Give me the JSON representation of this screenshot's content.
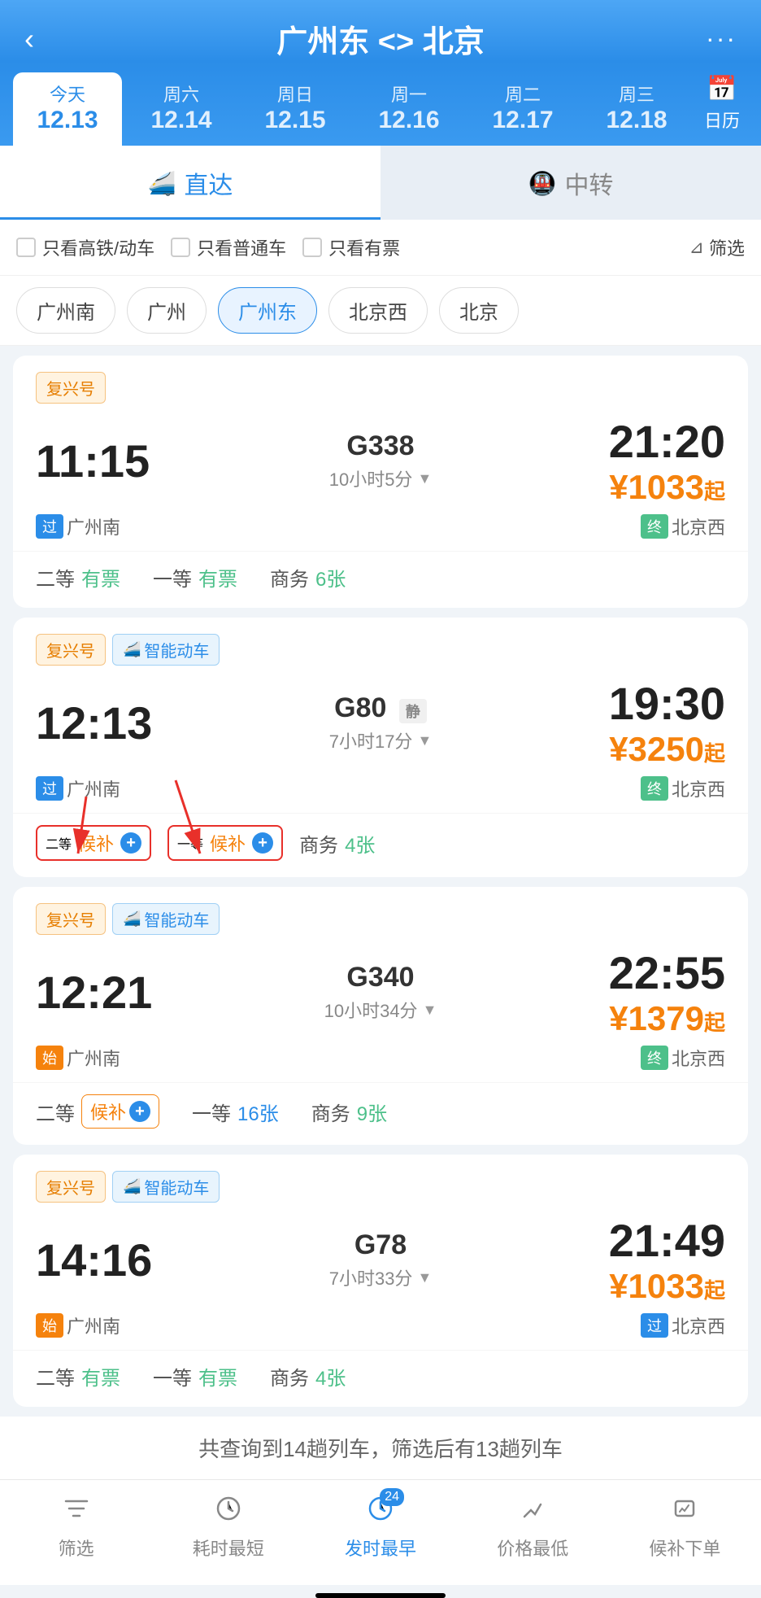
{
  "header": {
    "title": "广州东 <> 北京",
    "back_label": "‹",
    "more_label": "···"
  },
  "date_tabs": [
    {
      "day": "今天",
      "date": "12.13",
      "active": true
    },
    {
      "day": "周六",
      "date": "12.14",
      "active": false
    },
    {
      "day": "周日",
      "date": "12.15",
      "active": false
    },
    {
      "day": "周一",
      "date": "12.16",
      "active": false
    },
    {
      "day": "周二",
      "date": "12.17",
      "active": false
    },
    {
      "day": "周三",
      "date": "12.18",
      "active": false
    }
  ],
  "calendar_label": "日历",
  "tabs": {
    "direct": "直达",
    "transfer": "中转"
  },
  "filters": {
    "high_speed": "只看高铁/动车",
    "regular": "只看普通车",
    "available": "只看有票",
    "filter": "筛选"
  },
  "stations": [
    "广州南",
    "广州",
    "广州东",
    "北京西",
    "北京"
  ],
  "trains": [
    {
      "tags": [
        "复兴号"
      ],
      "depart_time": "11:15",
      "train_num": "G338",
      "arrive_time": "21:20",
      "price": "¥1033",
      "price_suffix": "起",
      "depart_station_badge": "过",
      "depart_station": "广州南",
      "arrive_station_badge": "终",
      "arrive_station": "北京西",
      "arrive_badge_color": "green",
      "duration": "10小时5分",
      "tickets": [
        {
          "class": "二等",
          "status": "有票",
          "type": "avail"
        },
        {
          "class": "一等",
          "status": "有票",
          "type": "avail"
        },
        {
          "class": "商务",
          "status": "6张",
          "type": "count"
        }
      ]
    },
    {
      "tags": [
        "复兴号",
        "智能动车"
      ],
      "depart_time": "12:13",
      "train_num": "G80",
      "quiet_badge": "静",
      "arrive_time": "19:30",
      "price": "¥3250",
      "price_suffix": "起",
      "depart_station_badge": "过",
      "depart_station": "广州南",
      "arrive_station_badge": "终",
      "arrive_station": "北京西",
      "arrive_badge_color": "green",
      "duration": "7小时17分",
      "tickets": [
        {
          "class": "二等",
          "status": "候补",
          "type": "waitlist_highlight"
        },
        {
          "class": "一等",
          "status": "候补",
          "type": "waitlist_highlight"
        },
        {
          "class": "商务",
          "status": "4张",
          "type": "count"
        }
      ]
    },
    {
      "tags": [
        "复兴号",
        "智能动车"
      ],
      "depart_time": "12:21",
      "train_num": "G340",
      "arrive_time": "22:55",
      "price": "¥1379",
      "price_suffix": "起",
      "depart_station_badge": "始",
      "depart_station": "广州南",
      "arrive_station_badge": "终",
      "arrive_station": "北京西",
      "arrive_badge_color": "green",
      "duration": "10小时34分",
      "tickets": [
        {
          "class": "二等",
          "status": "候补",
          "type": "waitlist"
        },
        {
          "class": "一等",
          "status": "16张",
          "type": "count_blue"
        },
        {
          "class": "商务",
          "status": "9张",
          "type": "count"
        }
      ]
    },
    {
      "tags": [
        "复兴号",
        "智能动车"
      ],
      "depart_time": "14:16",
      "train_num": "G78",
      "arrive_time": "21:49",
      "price": "¥1033",
      "price_suffix": "起",
      "depart_station_badge": "始",
      "depart_station": "广州南",
      "arrive_station_badge": "过",
      "arrive_station": "北京西",
      "arrive_badge_color": "blue",
      "duration": "7小时33分",
      "tickets": [
        {
          "class": "二等",
          "status": "有票",
          "type": "avail"
        },
        {
          "class": "一等",
          "status": "有票",
          "type": "avail"
        },
        {
          "class": "商务",
          "status": "4张",
          "type": "count"
        }
      ]
    }
  ],
  "summary": "共查询到14趟列车，筛选后有13趟列车",
  "bottom_nav": [
    {
      "icon": "⊿",
      "label": "筛选",
      "active": false
    },
    {
      "icon": "⏱",
      "label": "耗时最短",
      "active": false
    },
    {
      "icon": "🕐",
      "label": "发时最早",
      "active": true,
      "badge": "24"
    },
    {
      "icon": "◇",
      "label": "价格最低",
      "active": false
    },
    {
      "icon": "🛒",
      "label": "候补下单",
      "active": false
    }
  ]
}
